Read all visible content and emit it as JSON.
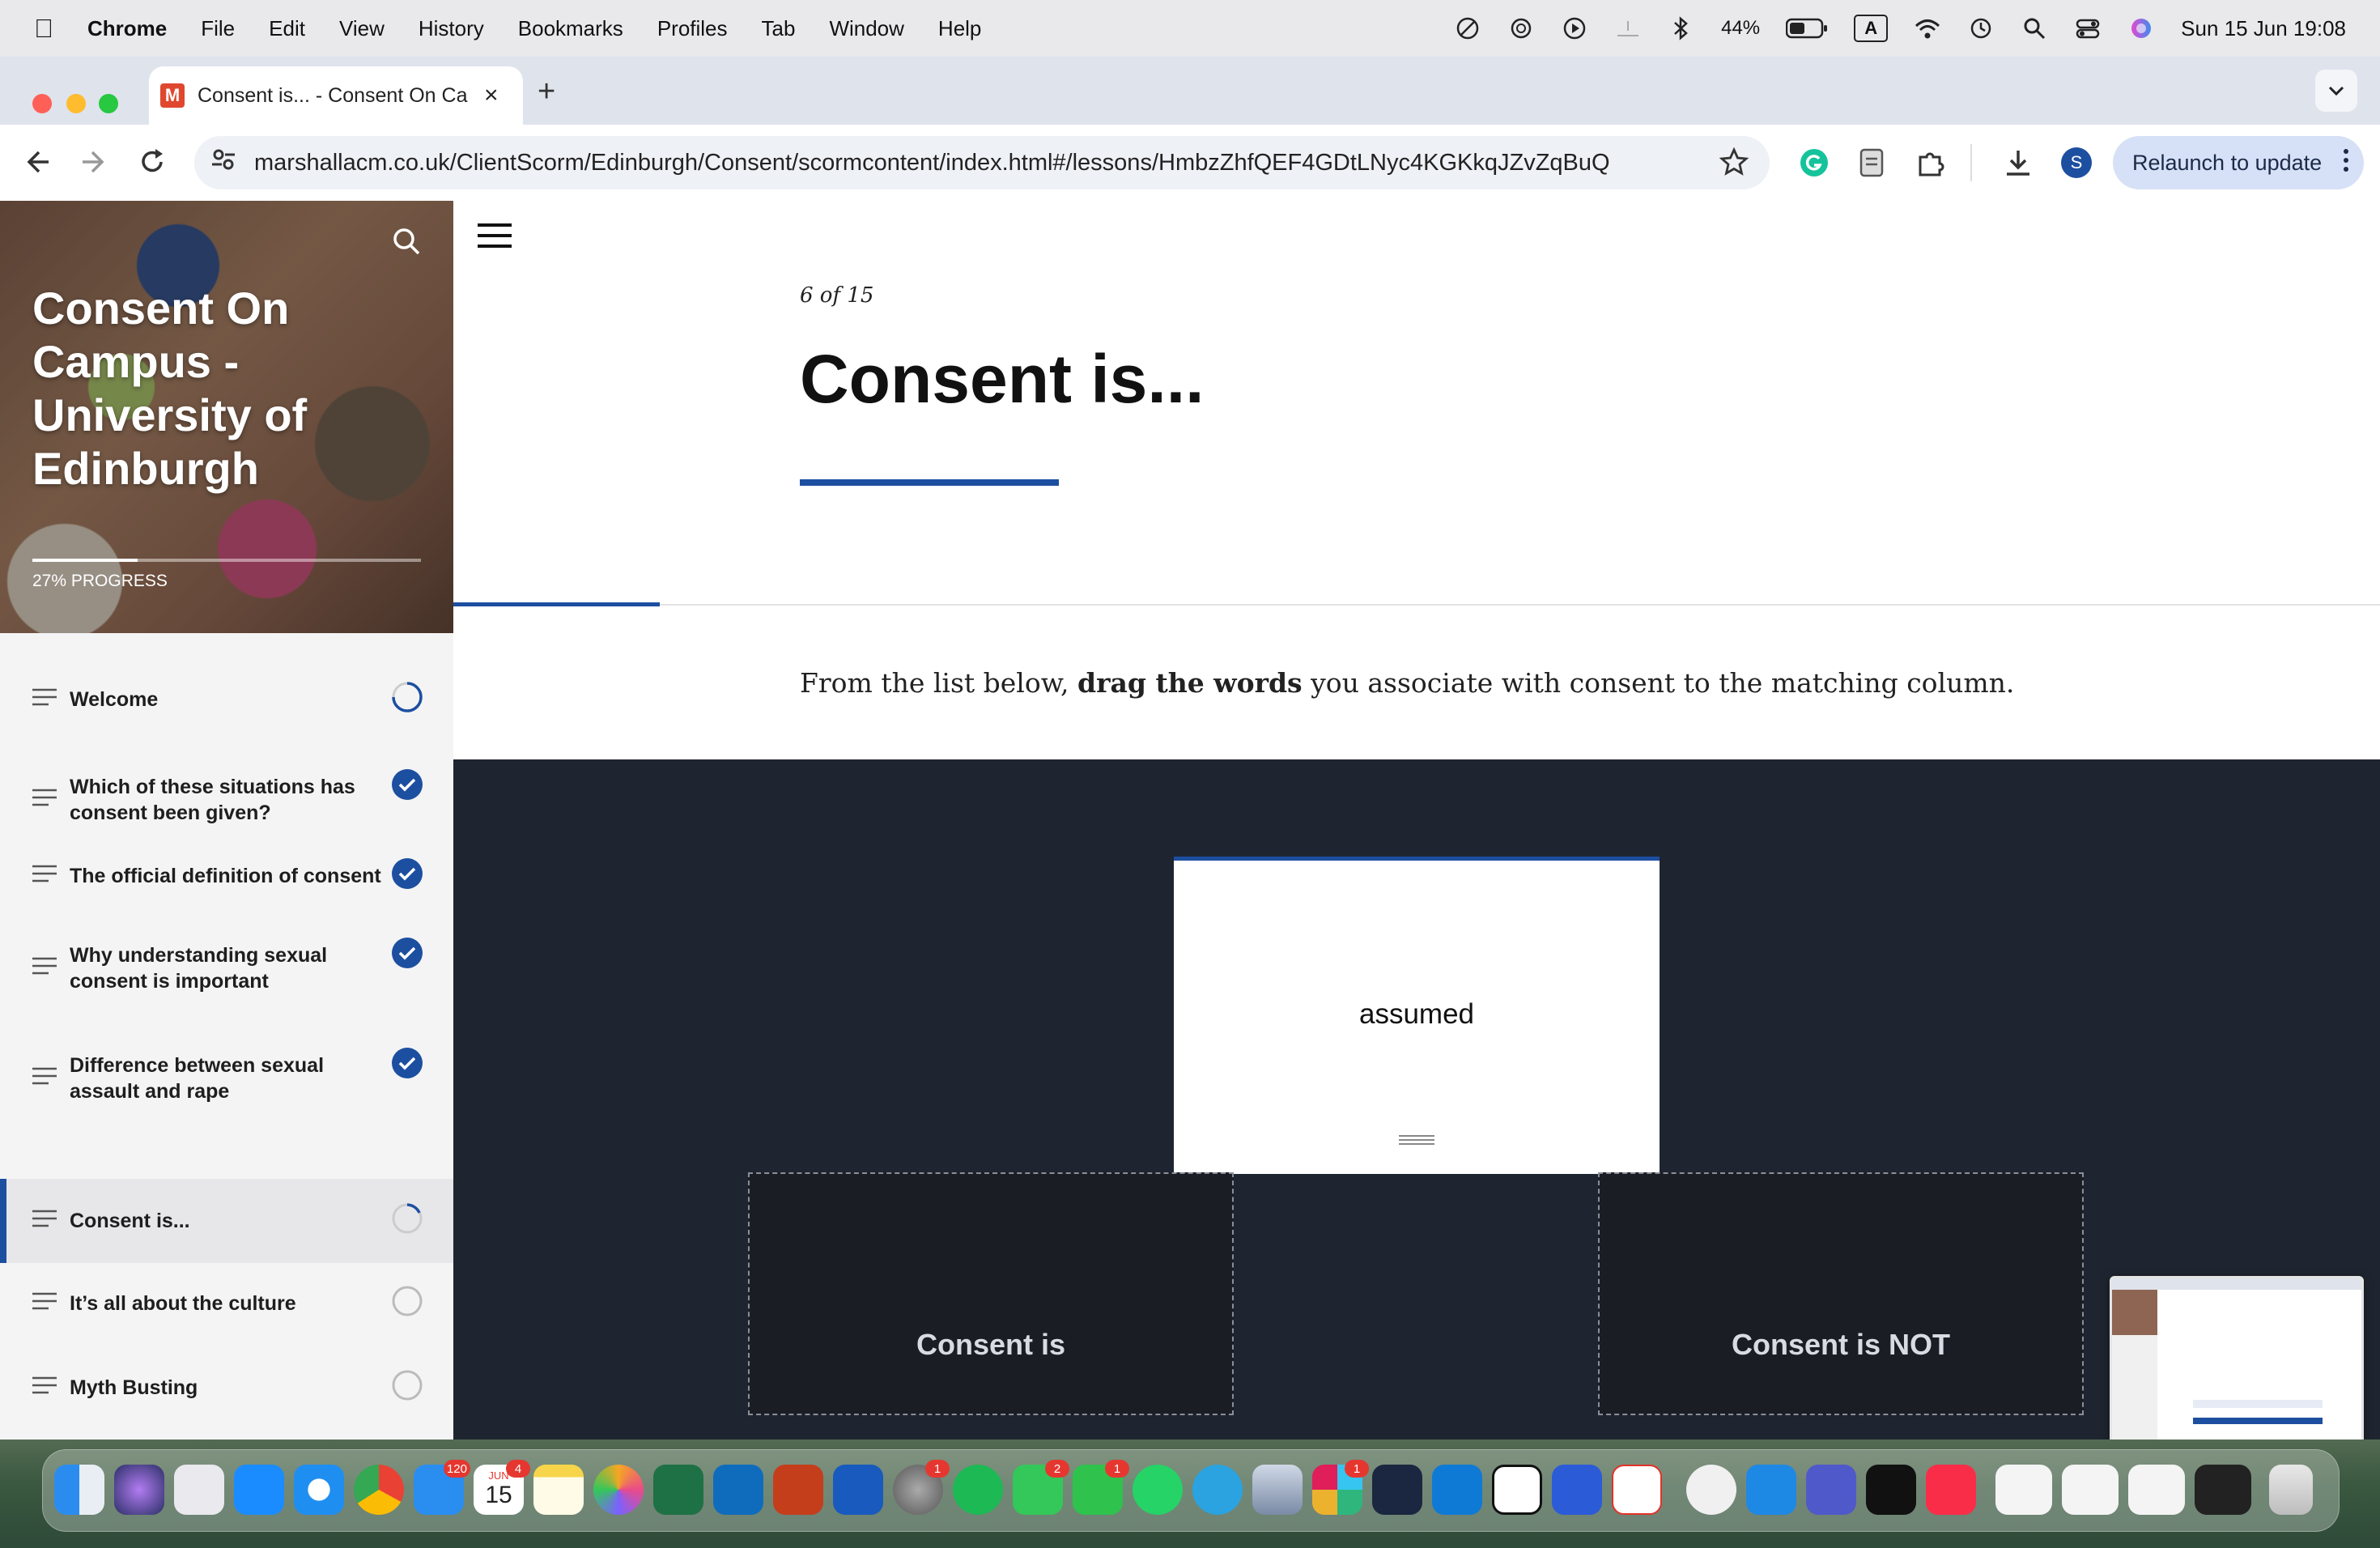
{
  "menubar": {
    "app": "Chrome",
    "items": [
      "File",
      "Edit",
      "View",
      "History",
      "Bookmarks",
      "Profiles",
      "Tab",
      "Window",
      "Help"
    ],
    "battery": "44%",
    "input_source": "A",
    "datetime": "Sun 15 Jun  19:08"
  },
  "browser": {
    "tab_title": "Consent is... - Consent On Ca",
    "favicon_letter": "M",
    "url": "marshallacm.co.uk/ClientScorm/Edinburgh/Consent/scormcontent/index.html#/lessons/HmbzZhfQEF4GDtLNyc4KGKkqJZvZqBuQ",
    "profile_initial": "S",
    "relaunch_label": "Relaunch to update"
  },
  "sidebar": {
    "course_title": "Consent On Campus - University of Edinburgh",
    "progress_label": "27% PROGRESS",
    "progress": 0.27,
    "lessons": [
      {
        "label": "Welcome",
        "status": "in-progress"
      },
      {
        "label": "Which of these situations has consent been given?",
        "status": "complete"
      },
      {
        "label": "The official definition of consent",
        "status": "complete"
      },
      {
        "label": "Why understanding sexual consent is important",
        "status": "complete"
      },
      {
        "label": "Difference between sexual assault and rape",
        "status": "complete"
      },
      {
        "label": "Consent is...",
        "status": "in-progress",
        "active": true
      },
      {
        "label": "It’s all about the culture",
        "status": "not-started"
      },
      {
        "label": "Myth Busting",
        "status": "not-started"
      }
    ]
  },
  "lesson": {
    "counter": "6 of 15",
    "title": "Consent is...",
    "lesson_progress": 0.107,
    "instruction_before": "From the list below, ",
    "instruction_bold": "drag the words",
    "instruction_after": " you associate with consent to the matching column.",
    "card_word": "assumed",
    "drop_left": "Consent is",
    "drop_right": "Consent is NOT"
  },
  "dock": {
    "mail_badge": "120",
    "calendar_month": "JUN",
    "calendar_day": "15",
    "calendar_badge": "4",
    "settings_badge": "1",
    "messages_badge": "2",
    "facetime_badge": "1",
    "slack_badge": "1"
  },
  "colors": {
    "accent": "#1d4fa0",
    "dark_panel": "#1f2530"
  }
}
